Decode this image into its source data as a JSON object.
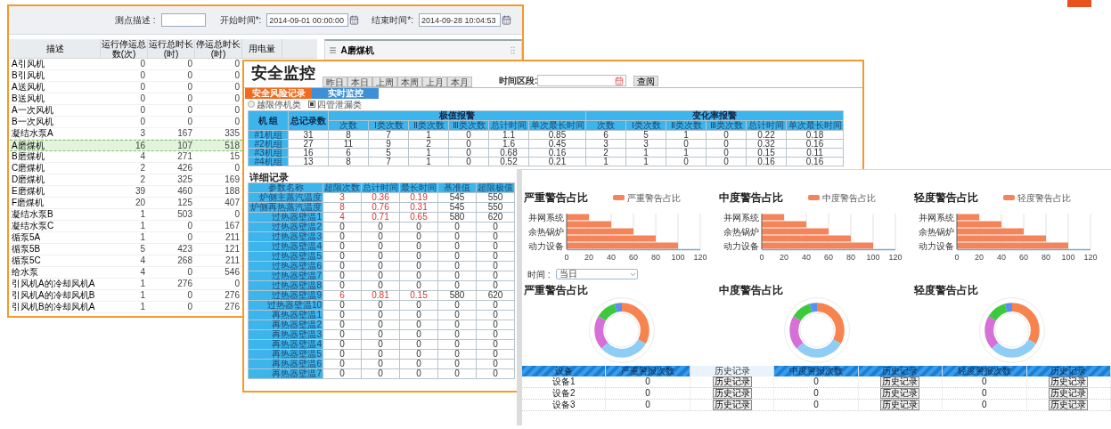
{
  "equipment_window": {
    "filters": [
      {
        "kind": "text",
        "label": "测点描述 :"
      },
      {
        "kind": "date",
        "label": "开始时间*:",
        "value": "2014-09-01 00:00:00"
      },
      {
        "kind": "date",
        "label": "结束时间*:",
        "value": "2014-09-28 10:04:53"
      }
    ],
    "table": {
      "columns": [
        "描述",
        "运行停运总数(次)",
        "运行总时长(时)",
        "停运总时长(时)",
        "用电量"
      ],
      "rows": [
        {
          "name": "A引风机",
          "values": [
            "0",
            "0",
            "0"
          ],
          "selected": false
        },
        {
          "name": "B引风机",
          "values": [
            "0",
            "0",
            "0"
          ],
          "selected": false
        },
        {
          "name": "A送风机",
          "values": [
            "0",
            "0",
            "0"
          ],
          "selected": false
        },
        {
          "name": "B送风机",
          "values": [
            "0",
            "0",
            "0"
          ],
          "selected": false
        },
        {
          "name": "A一次风机",
          "values": [
            "0",
            "0",
            "0"
          ],
          "selected": false
        },
        {
          "name": "B一次风机",
          "values": [
            "0",
            "0",
            "0"
          ],
          "selected": false
        },
        {
          "name": "凝结水泵A",
          "values": [
            "3",
            "167",
            "335"
          ],
          "selected": false
        },
        {
          "name": "A磨煤机",
          "values": [
            "16",
            "107",
            "518"
          ],
          "selected": true
        },
        {
          "name": "B磨煤机",
          "values": [
            "4",
            "271",
            "15"
          ],
          "selected": false
        },
        {
          "name": "C磨煤机",
          "values": [
            "2",
            "426",
            "0"
          ],
          "selected": false
        },
        {
          "name": "D磨煤机",
          "values": [
            "2",
            "325",
            "169"
          ],
          "selected": false
        },
        {
          "name": "E磨煤机",
          "values": [
            "39",
            "460",
            "188"
          ],
          "selected": false
        },
        {
          "name": "F磨煤机",
          "values": [
            "20",
            "125",
            "407"
          ],
          "selected": false
        },
        {
          "name": "凝结水泵B",
          "values": [
            "1",
            "503",
            "0"
          ],
          "selected": false
        },
        {
          "name": "凝结水泵C",
          "values": [
            "1",
            "0",
            "167"
          ],
          "selected": false
        },
        {
          "name": "循泵5A",
          "values": [
            "1",
            "0",
            "211"
          ],
          "selected": false
        },
        {
          "name": "循泵5B",
          "values": [
            "5",
            "423",
            "121"
          ],
          "selected": false
        },
        {
          "name": "循泵5C",
          "values": [
            "4",
            "268",
            "211"
          ],
          "selected": false
        },
        {
          "name": "给水泵",
          "values": [
            "4",
            "0",
            "546"
          ],
          "selected": false
        },
        {
          "name": "引风机A的冷却风机A",
          "values": [
            "1",
            "276",
            "0"
          ],
          "selected": false
        },
        {
          "name": "引风机A的冷却风机B",
          "values": [
            "1",
            "0",
            "276"
          ],
          "selected": false
        },
        {
          "name": "引风机B的冷却风机A",
          "values": [
            "1",
            "0",
            "276"
          ],
          "selected": false
        }
      ]
    },
    "side_panel": {
      "title": "A磨煤机"
    }
  },
  "safety_window": {
    "title": "安全监控",
    "periods": [
      {
        "label": "昨日",
        "selected": false
      },
      {
        "label": "本日",
        "selected": false
      },
      {
        "label": "上周",
        "selected": false
      },
      {
        "label": "本周",
        "selected": false
      },
      {
        "label": "上月",
        "selected": false
      },
      {
        "label": "本月",
        "selected": false
      }
    ],
    "range_label": "时间区段:",
    "query_button": "查阅",
    "tabs": [
      {
        "label": "安全风险记录",
        "selected": true
      },
      {
        "label": "实时监控",
        "selected": false
      }
    ],
    "categories": [
      {
        "label": "越限停机类",
        "selected": false
      },
      {
        "label": "四管泄漏类",
        "selected": true
      }
    ],
    "summary": {
      "unit_header": "机 组",
      "total_header": "总记录数",
      "groups": [
        {
          "title": "极值报警",
          "columns": [
            "次数",
            "Ⅰ类次数",
            "Ⅱ类次数",
            "Ⅲ类次数",
            "总计时间",
            "单次最长时间"
          ]
        },
        {
          "title": "变化率报警",
          "columns": [
            "次数",
            "Ⅰ类次数",
            "Ⅱ类次数",
            "Ⅲ类次数",
            "总计时间",
            "单次最长时间"
          ]
        }
      ],
      "rows": [
        {
          "unit": "#1机组",
          "total": "31",
          "values": [
            "8",
            "7",
            "1",
            "0",
            "1.1",
            "0.85",
            "6",
            "5",
            "1",
            "0",
            "0.22",
            "0.18"
          ]
        },
        {
          "unit": "#2机组",
          "total": "27",
          "values": [
            "11",
            "9",
            "2",
            "0",
            "1.6",
            "0.45",
            "3",
            "3",
            "0",
            "0",
            "0.32",
            "0.16"
          ]
        },
        {
          "unit": "#3机组",
          "total": "16",
          "values": [
            "6",
            "5",
            "1",
            "0",
            "0.68",
            "0.16",
            "2",
            "1",
            "1",
            "0",
            "0.15",
            "0.11"
          ]
        },
        {
          "unit": "#4机组",
          "total": "13",
          "values": [
            "8",
            "7",
            "1",
            "0",
            "0.52",
            "0.21",
            "1",
            "1",
            "0",
            "0",
            "0.16",
            "0.16"
          ]
        }
      ]
    },
    "detail": {
      "title": "详细记录",
      "columns": [
        "参数名称",
        "超限次数",
        "总计时间",
        "最长时间",
        "基准值",
        "超限极值"
      ],
      "rows": [
        {
          "name": "炉侧主蒸汽温度",
          "values": [
            "3",
            "0.36",
            "0.19",
            "545",
            "550"
          ],
          "alarm": true
        },
        {
          "name": "炉侧再热蒸汽温度",
          "values": [
            "8",
            "0.76",
            "0.31",
            "545",
            "550"
          ],
          "alarm": true
        },
        {
          "name": "过热器壁温1",
          "values": [
            "4",
            "0.71",
            "0.65",
            "580",
            "620"
          ],
          "alarm": true
        },
        {
          "name": "过热器壁温2",
          "values": [
            "0",
            "0",
            "0",
            "0",
            "0"
          ],
          "alarm": false
        },
        {
          "name": "过热器壁温3",
          "values": [
            "0",
            "0",
            "0",
            "0",
            "0"
          ],
          "alarm": false
        },
        {
          "name": "过热器壁温4",
          "values": [
            "0",
            "0",
            "0",
            "0",
            "0"
          ],
          "alarm": false
        },
        {
          "name": "过热器壁温5",
          "values": [
            "0",
            "0",
            "0",
            "0",
            "0"
          ],
          "alarm": false
        },
        {
          "name": "过热器壁温6",
          "values": [
            "0",
            "0",
            "0",
            "0",
            "0"
          ],
          "alarm": false
        },
        {
          "name": "过热器壁温7",
          "values": [
            "0",
            "0",
            "0",
            "0",
            "0"
          ],
          "alarm": false
        },
        {
          "name": "过热器壁温8",
          "values": [
            "0",
            "0",
            "0",
            "0",
            "0"
          ],
          "alarm": false
        },
        {
          "name": "过热器壁温9",
          "values": [
            "6",
            "0.81",
            "0.15",
            "580",
            "620"
          ],
          "alarm": true
        },
        {
          "name": "过热器壁温10",
          "values": [
            "0",
            "0",
            "0",
            "0",
            "0"
          ],
          "alarm": false
        },
        {
          "name": "再热器壁温1",
          "values": [
            "0",
            "0",
            "0",
            "0",
            "0"
          ],
          "alarm": false
        },
        {
          "name": "再热器壁温2",
          "values": [
            "0",
            "0",
            "0",
            "0",
            "0"
          ],
          "alarm": false
        },
        {
          "name": "再热器壁温3",
          "values": [
            "0",
            "0",
            "0",
            "0",
            "0"
          ],
          "alarm": false
        },
        {
          "name": "再热器壁温4",
          "values": [
            "0",
            "0",
            "0",
            "0",
            "0"
          ],
          "alarm": false
        },
        {
          "name": "再热器壁温5",
          "values": [
            "0",
            "0",
            "0",
            "0",
            "0"
          ],
          "alarm": false
        },
        {
          "name": "再热器壁温6",
          "values": [
            "0",
            "0",
            "0",
            "0",
            "0"
          ],
          "alarm": false
        },
        {
          "name": "再热器壁温7",
          "values": [
            "0",
            "0",
            "0",
            "0",
            "0"
          ],
          "alarm": false
        }
      ]
    }
  },
  "warning_window": {
    "bar_charts": [
      {
        "chart_data": {
          "type": "bar",
          "orientation": "horizontal",
          "grid": true,
          "title": "严重警告占比",
          "categories": [
            "并网系统",
            null,
            "余热锅炉",
            null,
            "动力设备"
          ],
          "series": [
            {
              "name": "严重警告占比",
              "color": "#f4845a",
              "values": [
                20,
                40,
                60,
                80,
                100
              ]
            }
          ],
          "xlim": [
            0,
            120
          ],
          "xticks": [
            0,
            20,
            40,
            60,
            80,
            100,
            120
          ]
        }
      },
      {
        "chart_data": {
          "type": "bar",
          "orientation": "horizontal",
          "grid": true,
          "title": "中度警告占比",
          "categories": [
            "并网系统",
            null,
            "余热锅炉",
            null,
            "动力设备"
          ],
          "series": [
            {
              "name": "中度警告占比",
              "color": "#f4845a",
              "values": [
                20,
                40,
                60,
                80,
                100
              ]
            }
          ],
          "xlim": [
            0,
            120
          ],
          "xticks": [
            0,
            20,
            40,
            60,
            80,
            100,
            120
          ]
        }
      },
      {
        "chart_data": {
          "type": "bar",
          "orientation": "horizontal",
          "grid": true,
          "title": "轻度警告占比",
          "categories": [
            "并网系统",
            null,
            "余热锅炉",
            null,
            "动力设备"
          ],
          "series": [
            {
              "name": "轻度警告占比",
              "color": "#f4845a",
              "values": [
                20,
                40,
                60,
                80,
                100
              ]
            }
          ],
          "xlim": [
            0,
            120
          ],
          "xticks": [
            0,
            20,
            40,
            60,
            80,
            100,
            120
          ]
        }
      }
    ],
    "time_filter": {
      "label": "时间 :",
      "value": "当日"
    },
    "donut_titles": [
      "严重警告占比",
      "中度警告占比",
      "轻度警告占比"
    ],
    "table": {
      "columns": [
        {
          "label": "设备",
          "highlighted": false
        },
        {
          "label": "严重警报次数",
          "highlighted": false
        },
        {
          "label": "历史记录",
          "highlighted": true
        },
        {
          "label": "中度警报次数",
          "highlighted": false
        },
        {
          "label": "历史记录",
          "highlighted": false
        },
        {
          "label": "轻度警报次数",
          "highlighted": false
        },
        {
          "label": "历史记录",
          "highlighted": false
        }
      ],
      "rows": [
        [
          {
            "kind": "text",
            "text": "设备1"
          },
          {
            "kind": "text",
            "text": "0"
          },
          {
            "kind": "button",
            "text": "历史记录"
          },
          {
            "kind": "text",
            "text": "0"
          },
          {
            "kind": "button",
            "text": "历史记录"
          },
          {
            "kind": "text",
            "text": "0"
          },
          {
            "kind": "button",
            "text": "历史记录"
          }
        ],
        [
          {
            "kind": "text",
            "text": "设备2"
          },
          {
            "kind": "text",
            "text": "0"
          },
          {
            "kind": "button",
            "text": "历史记录"
          },
          {
            "kind": "text",
            "text": "0"
          },
          {
            "kind": "button",
            "text": "历史记录"
          },
          {
            "kind": "text",
            "text": "0"
          },
          {
            "kind": "button",
            "text": "历史记录"
          }
        ],
        [
          {
            "kind": "text",
            "text": "设备3"
          },
          {
            "kind": "text",
            "text": "0"
          },
          {
            "kind": "button",
            "text": "历史记录"
          },
          {
            "kind": "text",
            "text": "0"
          },
          {
            "kind": "button",
            "text": "历史记录"
          },
          {
            "kind": "text",
            "text": "0"
          },
          {
            "kind": "button",
            "text": "历史记录"
          }
        ]
      ]
    }
  }
}
